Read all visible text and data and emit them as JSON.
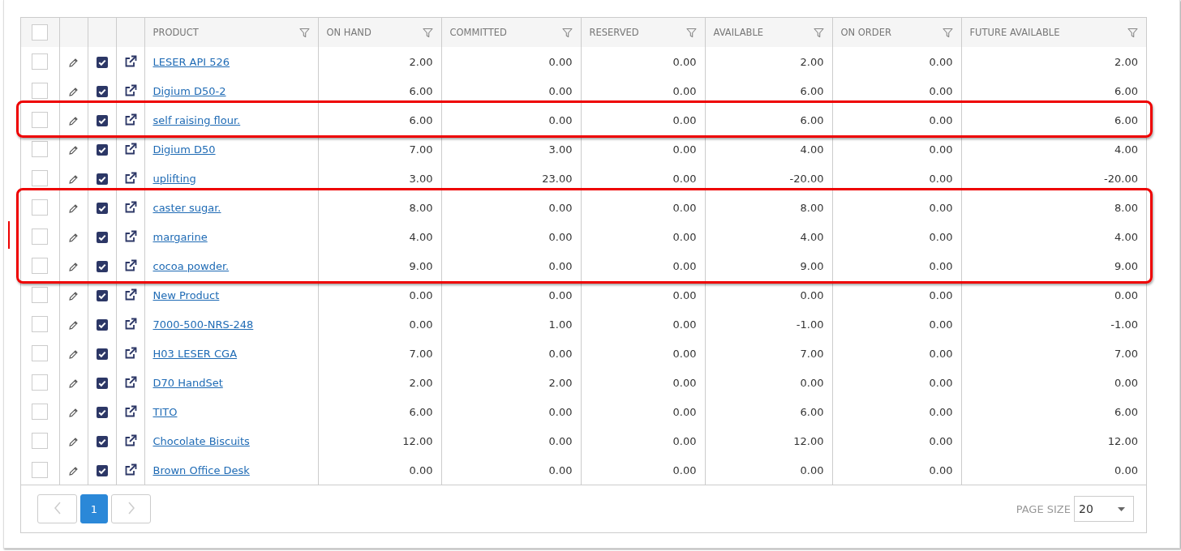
{
  "table": {
    "header_checkbox": {
      "checked": false
    },
    "columns": [
      {
        "label": "PRODUCT"
      },
      {
        "label": "ON HAND"
      },
      {
        "label": "COMMITTED"
      },
      {
        "label": "RESERVED"
      },
      {
        "label": "AVAILABLE"
      },
      {
        "label": "ON ORDER"
      },
      {
        "label": "FUTURE AVAILABLE"
      }
    ],
    "rows": [
      {
        "selected": false,
        "checked": true,
        "highlighted": false,
        "side_mark": false,
        "product": "LESER API 526",
        "values": [
          "2.00",
          "0.00",
          "0.00",
          "2.00",
          "0.00",
          "2.00"
        ]
      },
      {
        "selected": false,
        "checked": true,
        "highlighted": false,
        "side_mark": false,
        "product": "Digium D50-2",
        "values": [
          "6.00",
          "0.00",
          "0.00",
          "6.00",
          "0.00",
          "6.00"
        ]
      },
      {
        "selected": false,
        "checked": true,
        "highlighted": true,
        "side_mark": false,
        "product": "self raising flour.",
        "values": [
          "6.00",
          "0.00",
          "0.00",
          "6.00",
          "0.00",
          "6.00"
        ]
      },
      {
        "selected": false,
        "checked": true,
        "highlighted": false,
        "side_mark": false,
        "product": "Digium D50",
        "values": [
          "7.00",
          "3.00",
          "0.00",
          "4.00",
          "0.00",
          "4.00"
        ]
      },
      {
        "selected": false,
        "checked": true,
        "highlighted": false,
        "side_mark": false,
        "product": "uplifting",
        "values": [
          "3.00",
          "23.00",
          "0.00",
          "-20.00",
          "0.00",
          "-20.00"
        ]
      },
      {
        "selected": false,
        "checked": true,
        "highlighted": true,
        "side_mark": false,
        "product": "caster sugar.",
        "values": [
          "8.00",
          "0.00",
          "0.00",
          "8.00",
          "0.00",
          "8.00"
        ]
      },
      {
        "selected": false,
        "checked": true,
        "highlighted": true,
        "side_mark": true,
        "product": "margarine",
        "values": [
          "4.00",
          "0.00",
          "0.00",
          "4.00",
          "0.00",
          "4.00"
        ]
      },
      {
        "selected": false,
        "checked": true,
        "highlighted": true,
        "side_mark": false,
        "product": "cocoa powder.",
        "values": [
          "9.00",
          "0.00",
          "0.00",
          "9.00",
          "0.00",
          "9.00"
        ]
      },
      {
        "selected": false,
        "checked": true,
        "highlighted": false,
        "side_mark": false,
        "product": "New Product",
        "values": [
          "0.00",
          "0.00",
          "0.00",
          "0.00",
          "0.00",
          "0.00"
        ]
      },
      {
        "selected": false,
        "checked": true,
        "highlighted": false,
        "side_mark": false,
        "product": "7000-500-NRS-248",
        "values": [
          "0.00",
          "1.00",
          "0.00",
          "-1.00",
          "0.00",
          "-1.00"
        ]
      },
      {
        "selected": false,
        "checked": true,
        "highlighted": false,
        "side_mark": false,
        "product": "H03 LESER CGA",
        "values": [
          "7.00",
          "0.00",
          "0.00",
          "7.00",
          "0.00",
          "7.00"
        ]
      },
      {
        "selected": false,
        "checked": true,
        "highlighted": false,
        "side_mark": false,
        "product": "D70 HandSet",
        "values": [
          "2.00",
          "2.00",
          "0.00",
          "0.00",
          "0.00",
          "0.00"
        ]
      },
      {
        "selected": false,
        "checked": true,
        "highlighted": false,
        "side_mark": false,
        "product": "TITO",
        "values": [
          "6.00",
          "0.00",
          "0.00",
          "6.00",
          "0.00",
          "6.00"
        ]
      },
      {
        "selected": false,
        "checked": true,
        "highlighted": false,
        "side_mark": false,
        "product": "Chocolate Biscuits",
        "values": [
          "12.00",
          "0.00",
          "0.00",
          "12.00",
          "0.00",
          "12.00"
        ]
      },
      {
        "selected": false,
        "checked": true,
        "highlighted": false,
        "side_mark": false,
        "product": "Brown Office Desk",
        "values": [
          "0.00",
          "0.00",
          "0.00",
          "0.00",
          "0.00",
          "0.00"
        ]
      }
    ]
  },
  "pager": {
    "pages": [
      {
        "label": "1",
        "selected": true
      }
    ],
    "page_size_label": "PAGE SIZE",
    "page_size": "20"
  }
}
